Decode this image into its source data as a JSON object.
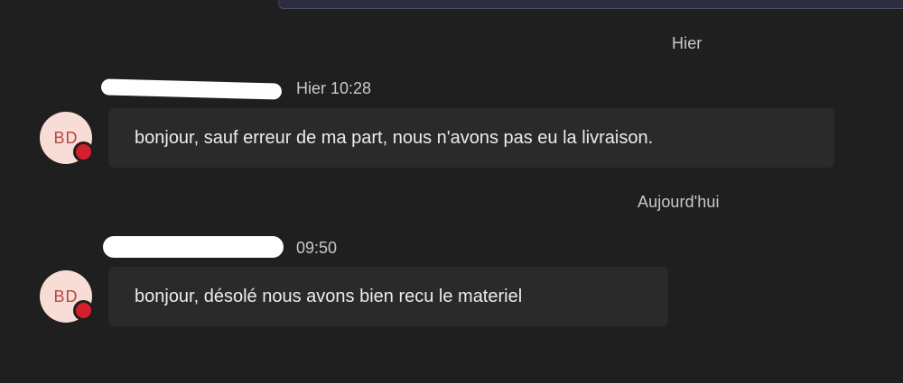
{
  "dividers": {
    "yesterday": "Hier",
    "today": "Aujourd'hui"
  },
  "messages": [
    {
      "avatar_initials": "BD",
      "time": "Hier 10:28",
      "text": "bonjour, sauf erreur de ma part, nous n'avons pas eu la livraison."
    },
    {
      "avatar_initials": "BD",
      "time": "09:50",
      "text": "bonjour, désolé nous avons bien recu le materiel"
    }
  ]
}
